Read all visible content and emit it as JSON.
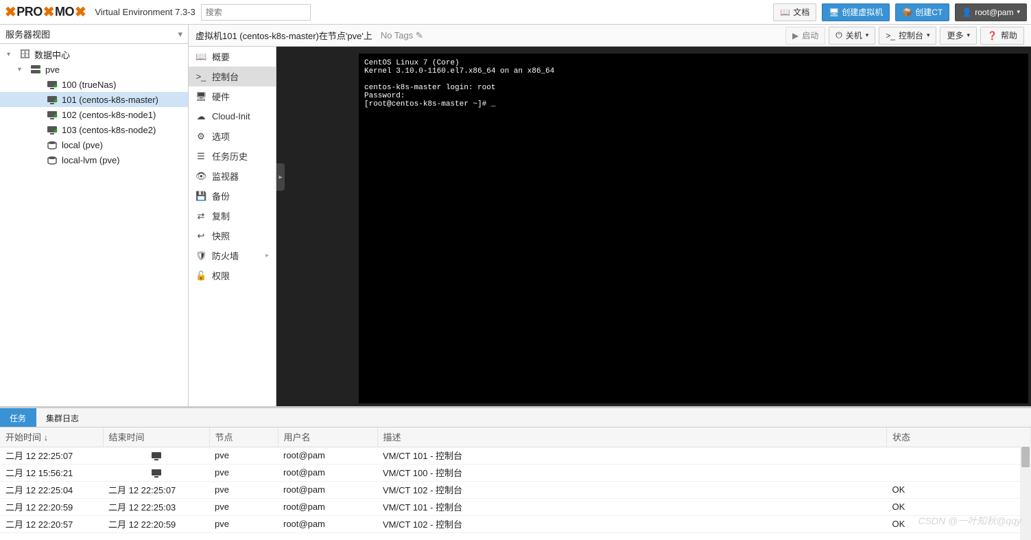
{
  "header": {
    "brand_a": "PRO",
    "brand_b": "MO",
    "env": "Virtual Environment 7.3-3",
    "search_placeholder": "搜索",
    "docs": "文档",
    "create_vm": "创建虚拟机",
    "create_ct": "创建CT",
    "user": "root@pam"
  },
  "sidebar": {
    "view": "服务器视图",
    "root": "数据中心",
    "node": "pve",
    "items": [
      {
        "label": "100 (trueNas)"
      },
      {
        "label": "101 (centos-k8s-master)"
      },
      {
        "label": "102 (centos-k8s-node1)"
      },
      {
        "label": "103 (centos-k8s-node2)"
      },
      {
        "label": "local (pve)"
      },
      {
        "label": "local-lvm (pve)"
      }
    ]
  },
  "breadcrumb": {
    "title": "虚拟机101 (centos-k8s-master)在节点'pve'上",
    "no_tags": "No Tags",
    "start": "启动",
    "shutdown": "关机",
    "console": "控制台",
    "more": "更多",
    "help": "帮助"
  },
  "submenu": {
    "items": [
      {
        "icon": "book",
        "label": "概要"
      },
      {
        "icon": "term",
        "label": "控制台"
      },
      {
        "icon": "hw",
        "label": "硬件"
      },
      {
        "icon": "cloud",
        "label": "Cloud-Init"
      },
      {
        "icon": "gear",
        "label": "选项"
      },
      {
        "icon": "list",
        "label": "任务历史"
      },
      {
        "icon": "eye",
        "label": "监视器"
      },
      {
        "icon": "save",
        "label": "备份"
      },
      {
        "icon": "sync",
        "label": "复制"
      },
      {
        "icon": "undo",
        "label": "快照"
      },
      {
        "icon": "shield",
        "label": "防火墙",
        "arrow": true
      },
      {
        "icon": "unlock",
        "label": "权限"
      }
    ],
    "active": 1
  },
  "terminal": "CentOS Linux 7 (Core)\nKernel 3.10.0-1160.el7.x86_64 on an x86_64\n\ncentos-k8s-master login: root\nPassword:\n[root@centos-k8s-master ~]# _",
  "footer": {
    "tabs": {
      "tasks": "任务",
      "cluster": "集群日志"
    },
    "cols": {
      "start": "开始时间 ↓",
      "end": "结束时间",
      "node": "节点",
      "user": "用户名",
      "desc": "描述",
      "status": "状态"
    },
    "rows": [
      {
        "start": "二月 12 22:25:07",
        "end_icon": true,
        "end": "",
        "node": "pve",
        "user": "root@pam",
        "desc": "VM/CT 101 - 控制台",
        "status": ""
      },
      {
        "start": "二月 12 15:56:21",
        "end_icon": true,
        "end": "",
        "node": "pve",
        "user": "root@pam",
        "desc": "VM/CT 100 - 控制台",
        "status": ""
      },
      {
        "start": "二月 12 22:25:04",
        "end": "二月 12 22:25:07",
        "node": "pve",
        "user": "root@pam",
        "desc": "VM/CT 102 - 控制台",
        "status": "OK"
      },
      {
        "start": "二月 12 22:20:59",
        "end": "二月 12 22:25:03",
        "node": "pve",
        "user": "root@pam",
        "desc": "VM/CT 101 - 控制台",
        "status": "OK"
      },
      {
        "start": "二月 12 22:20:57",
        "end": "二月 12 22:20:59",
        "node": "pve",
        "user": "root@pam",
        "desc": "VM/CT 102 - 控制台",
        "status": "OK"
      }
    ]
  },
  "watermark": "CSDN @一叶知秋@qqy"
}
